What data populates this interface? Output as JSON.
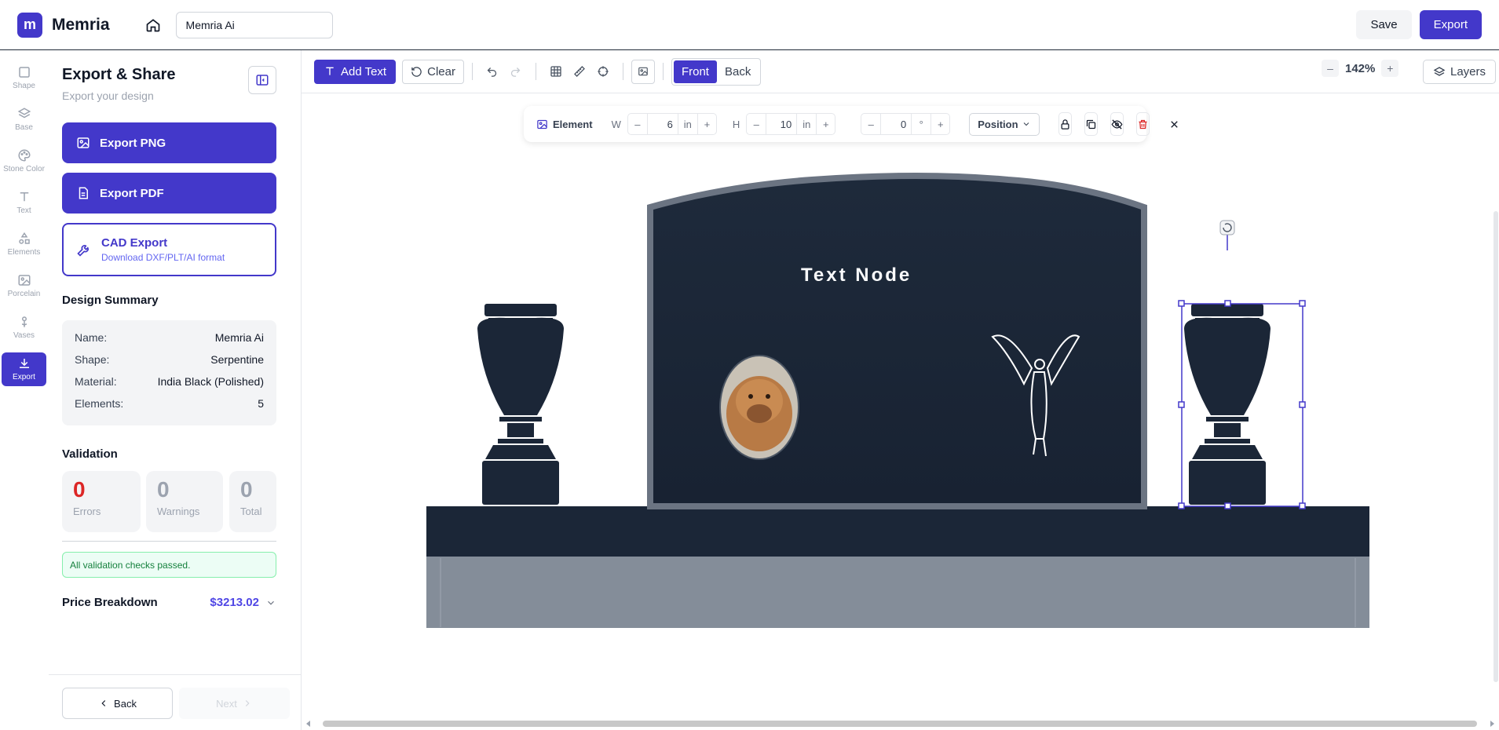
{
  "app": {
    "brand": "Memria",
    "logo_letter": "m",
    "design_name": "Memria Ai"
  },
  "header": {
    "save_label": "Save",
    "export_label": "Export"
  },
  "rail": {
    "items": [
      {
        "label": "Shape"
      },
      {
        "label": "Base"
      },
      {
        "label": "Stone Color"
      },
      {
        "label": "Text"
      },
      {
        "label": "Elements"
      },
      {
        "label": "Porcelain"
      },
      {
        "label": "Vases"
      },
      {
        "label": "Export"
      }
    ]
  },
  "panel": {
    "title": "Export & Share",
    "subtitle": "Export your design",
    "export_png": "Export PNG",
    "export_pdf": "Export PDF",
    "cad_title": "CAD Export",
    "cad_sub": "Download DXF/PLT/AI format",
    "summary_title": "Design Summary",
    "summary": [
      {
        "key": "Name:",
        "value": "Memria Ai"
      },
      {
        "key": "Shape:",
        "value": "Serpentine"
      },
      {
        "key": "Material:",
        "value": "India Black (Polished)"
      },
      {
        "key": "Elements:",
        "value": "5"
      }
    ],
    "validation_title": "Validation",
    "validation": [
      {
        "count": "0",
        "label": "Errors"
      },
      {
        "count": "0",
        "label": "Warnings"
      },
      {
        "count": "0",
        "label": "Total"
      }
    ],
    "validation_message": "All validation checks passed.",
    "price_label": "Price Breakdown",
    "price_value": "$3213.02",
    "back_label": "Back",
    "next_label": "Next"
  },
  "toolbar": {
    "add_text": "Add Text",
    "clear": "Clear",
    "front": "Front",
    "back": "Back",
    "zoom": "142%",
    "layers": "Layers"
  },
  "element_bar": {
    "label": "Element",
    "w_label": "W",
    "w_value": "6",
    "w_unit": "in",
    "h_label": "H",
    "h_value": "10",
    "h_unit": "in",
    "rot_value": "0",
    "rot_unit": "°",
    "position_label": "Position"
  },
  "canvas": {
    "text_node": "Text Node"
  },
  "colors": {
    "accent": "#4338ca",
    "stone": "#1b2637",
    "base_gray": "#848d99",
    "danger": "#dc2626"
  }
}
